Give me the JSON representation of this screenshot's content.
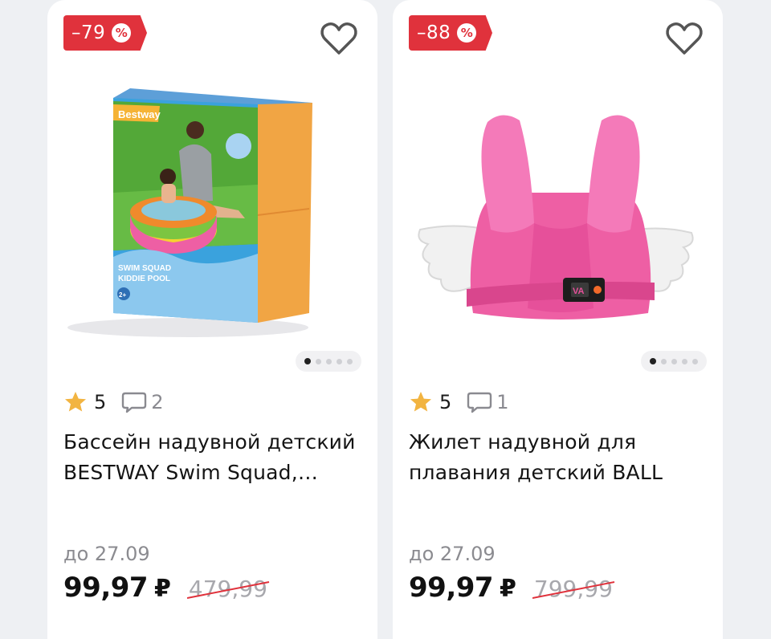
{
  "colors": {
    "discount": "#e0323c",
    "star": "#f2b441",
    "strike": "#e0323c",
    "pool_pink": "#ee5fa4"
  },
  "products": [
    {
      "discount": "–79",
      "discount_symbol": "%",
      "rating": "5",
      "reviews": "2",
      "title": "Бассейн надувной детский BESTWAY Swim Squad, Kiddie Pool",
      "promo_date": "до 27.09",
      "price": "99,97",
      "currency": "₽",
      "old_price": "479,99",
      "image": {
        "brand": "Bestway",
        "line1": "SWIM SQUAD",
        "line2": "KIDDIE POOL",
        "age": "2+"
      },
      "carousel": {
        "count": 5,
        "active": 0
      }
    },
    {
      "discount": "–88",
      "discount_symbol": "%",
      "rating": "5",
      "reviews": "1",
      "title": "Жилет надувной для плавания детский BALL",
      "promo_date": "до 27.09",
      "price": "99,97",
      "currency": "₽",
      "old_price": "799,99",
      "image": {
        "logo": "VA"
      },
      "carousel": {
        "count": 5,
        "active": 0
      }
    }
  ]
}
